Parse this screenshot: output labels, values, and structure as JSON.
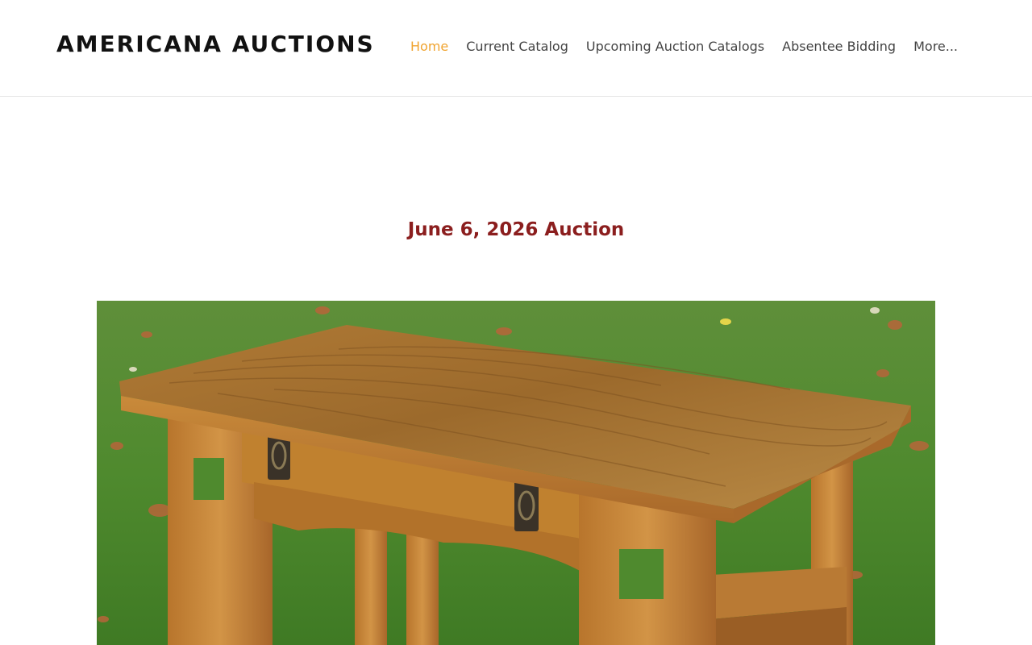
{
  "site": {
    "logo": "AMERICANA AUCTIONS"
  },
  "nav": {
    "items": [
      {
        "label": "Home",
        "active": true
      },
      {
        "label": "Current Catalog"
      },
      {
        "label": "Upcoming Auction Catalogs"
      },
      {
        "label": "Absentee Bidding"
      },
      {
        "label": "More..."
      }
    ]
  },
  "main": {
    "title": "June 6, 2026 Auction",
    "hero_image": "oak-library-table-photo"
  },
  "colors": {
    "accent_active": "#f0a430",
    "title": "#8b1e1e",
    "nav_text": "#444444"
  }
}
